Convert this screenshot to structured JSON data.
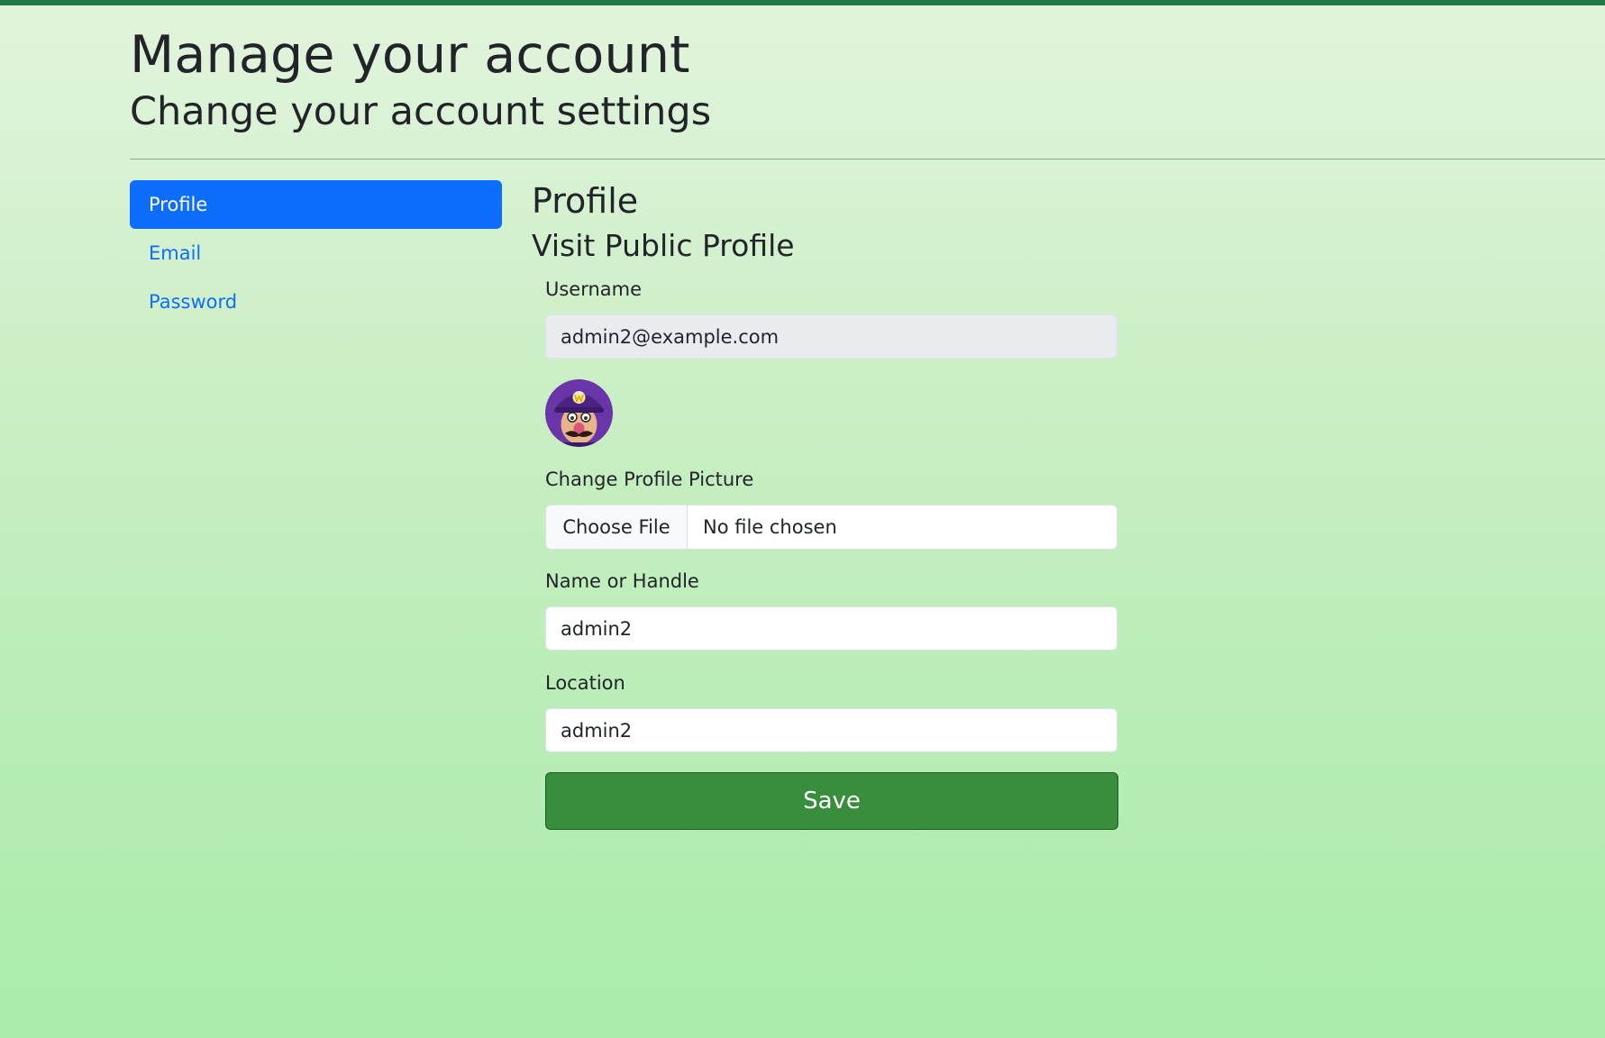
{
  "header": {
    "title": "Manage your account",
    "subtitle": "Change your account settings"
  },
  "sidebar": {
    "items": [
      {
        "label": "Profile",
        "active": true
      },
      {
        "label": "Email",
        "active": false
      },
      {
        "label": "Password",
        "active": false
      }
    ]
  },
  "profile": {
    "heading": "Profile",
    "public_link": "Visit Public Profile",
    "username_label": "Username",
    "username_value": "admin2@example.com",
    "avatar_icon": "avatar-image",
    "picture_label": "Change Profile Picture",
    "choose_file_label": "Choose File",
    "file_status": "No file chosen",
    "name_label": "Name or Handle",
    "name_value": "admin2",
    "location_label": "Location",
    "location_value": "admin2",
    "save_label": "Save"
  },
  "colors": {
    "top_bar": "#1f7a4a",
    "primary": "#0d6efd",
    "save_button": "#388e3c",
    "background_top": "#e2f4dd",
    "background_bottom": "#a9ecab"
  }
}
